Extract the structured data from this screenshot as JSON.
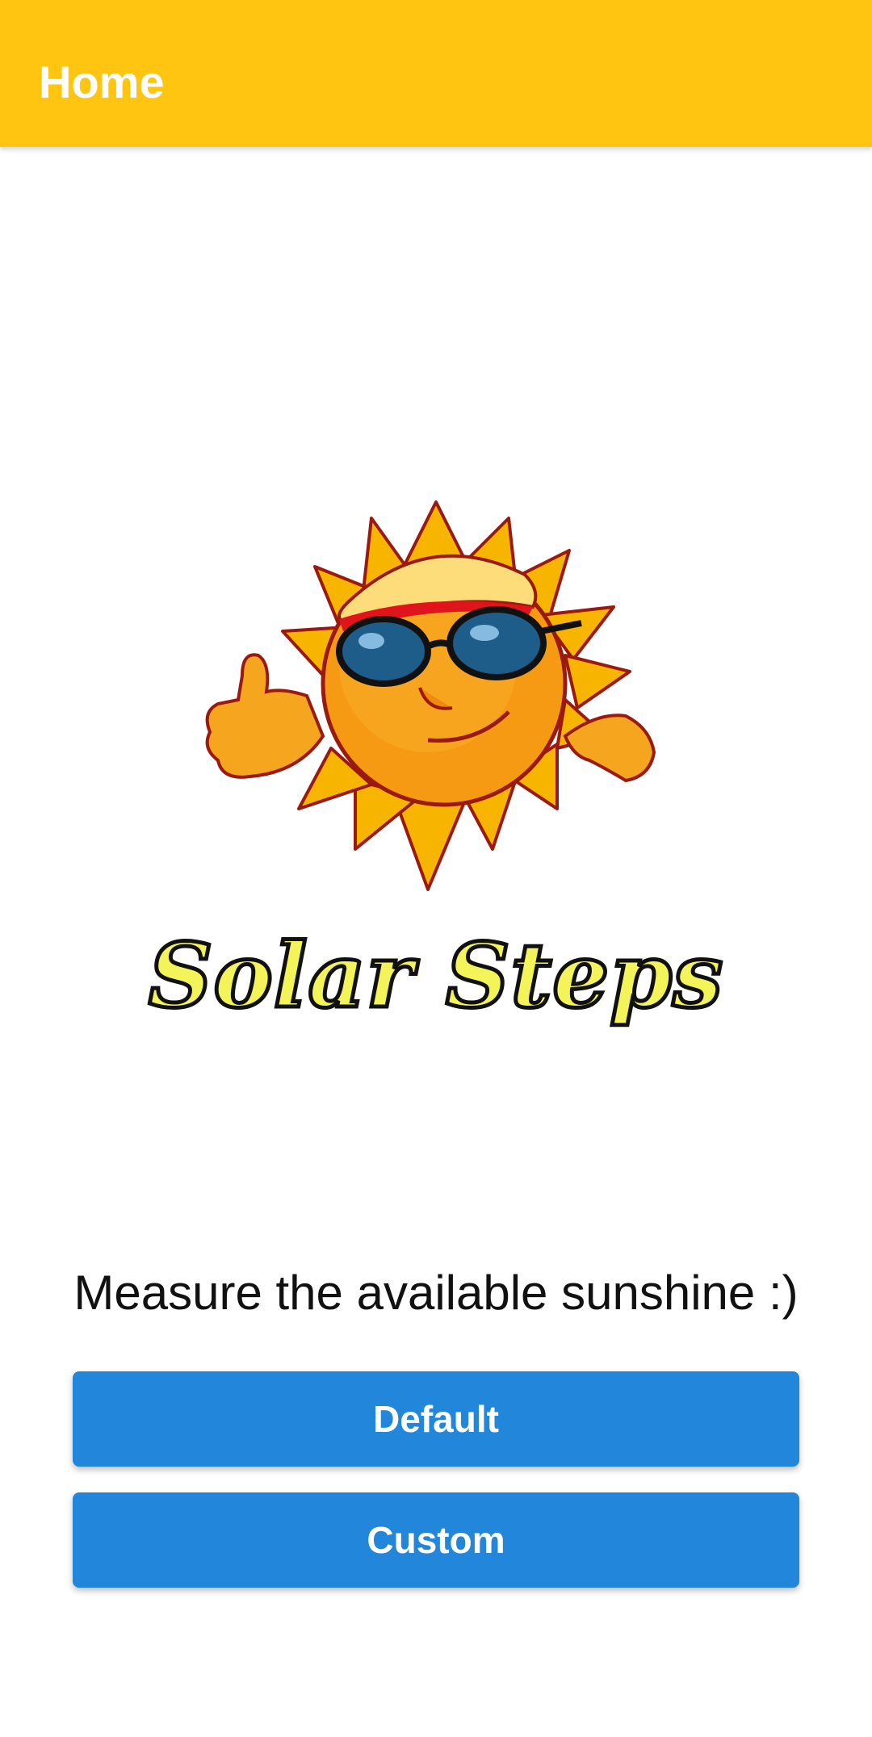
{
  "app_bar": {
    "title": "Home"
  },
  "logo": {
    "icon": "sun-mascot-icon",
    "wordmark": "Solar Steps"
  },
  "main": {
    "tagline": "Measure the available sunshine :)",
    "default_button_label": "Default",
    "custom_button_label": "Custom"
  },
  "colors": {
    "app_bar": "#FFC511",
    "button": "#2287DB",
    "wordmark_fill": "#F3F35A"
  }
}
